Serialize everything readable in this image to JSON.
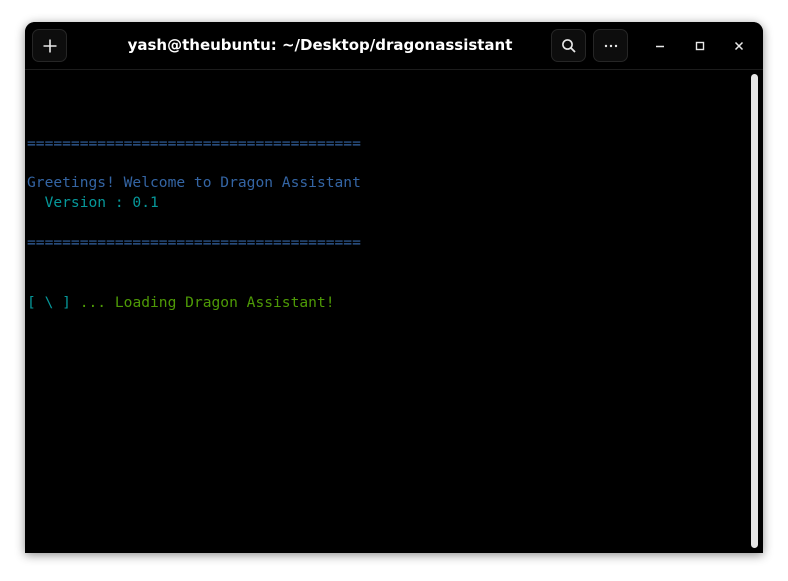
{
  "window": {
    "title": "yash@theubuntu: ~/Desktop/dragonassistant"
  },
  "icons": {
    "new_tab": "plus-icon",
    "search": "search-icon",
    "menu": "ellipsis-icon",
    "minimize": "minimize-icon",
    "maximize": "maximize-icon",
    "close": "close-icon"
  },
  "terminal": {
    "rule_top": "======================================",
    "greeting": "Greetings! Welcome to Dragon Assistant",
    "version": "  Version : 0.1",
    "rule_bottom": "======================================",
    "spinner": "[ \\ ]",
    "loading": " ... Loading Dragon Assistant!"
  },
  "colors": {
    "background": "#000000",
    "rule": "#3465a4",
    "greeting": "#3465a4",
    "version": "#06989a",
    "spinner": "#06989a",
    "loading": "#4e9a06"
  }
}
